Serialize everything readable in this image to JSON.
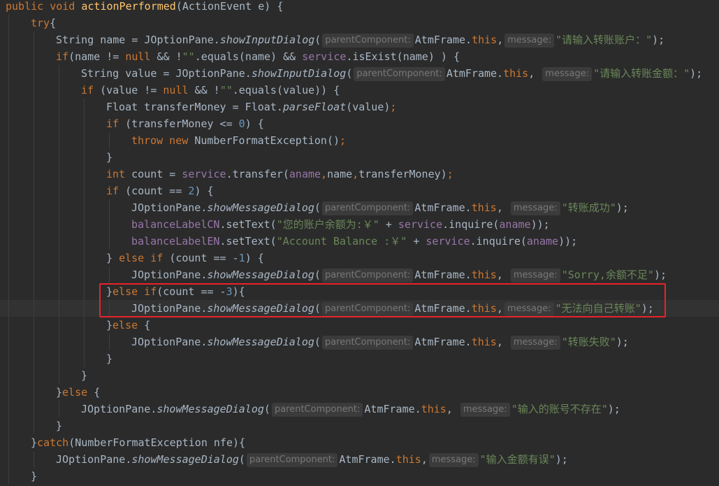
{
  "editor": {
    "lines": [
      {
        "indent": 0,
        "tokens": [
          {
            "t": "public void ",
            "c": "kw"
          },
          {
            "t": "actionPerformed",
            "c": "mth"
          },
          {
            "t": "(ActionEvent e) {"
          }
        ]
      },
      {
        "indent": 1,
        "tokens": [
          {
            "t": "try",
            "c": "kw"
          },
          {
            "t": "{"
          }
        ]
      },
      {
        "indent": 2,
        "tokens": [
          {
            "t": "String name = JOptionPane."
          },
          {
            "t": "showInputDialog",
            "c": "stat"
          },
          {
            "t": "("
          },
          {
            "t": "parentComponent:",
            "c": "hint"
          },
          {
            "t": "AtmFrame."
          },
          {
            "t": "this",
            "c": "kw"
          },
          {
            "t": ","
          },
          {
            "t": "message:",
            "c": "hint"
          },
          {
            "t": "\"请输入转账账户：\"",
            "c": "str"
          },
          {
            "t": ");"
          }
        ]
      },
      {
        "indent": 2,
        "tokens": [
          {
            "t": "if",
            "c": "kw"
          },
          {
            "t": "(name != "
          },
          {
            "t": "null",
            "c": "kw"
          },
          {
            "t": " && !"
          },
          {
            "t": "\"\"",
            "c": "str"
          },
          {
            "t": ".equals(name) && "
          },
          {
            "t": "service",
            "c": "fld"
          },
          {
            "t": ".isExist(name) ) {"
          }
        ]
      },
      {
        "indent": 3,
        "tokens": [
          {
            "t": "String value = JOptionPane."
          },
          {
            "t": "showInputDialog",
            "c": "stat"
          },
          {
            "t": "("
          },
          {
            "t": "parentComponent:",
            "c": "hint"
          },
          {
            "t": "AtmFrame."
          },
          {
            "t": "this",
            "c": "kw"
          },
          {
            "t": ", "
          },
          {
            "t": "message:",
            "c": "hint"
          },
          {
            "t": "\"请输入转账金额：\"",
            "c": "str"
          },
          {
            "t": ");"
          }
        ]
      },
      {
        "indent": 3,
        "tokens": [
          {
            "t": "if ",
            "c": "kw"
          },
          {
            "t": "(value != "
          },
          {
            "t": "null",
            "c": "kw"
          },
          {
            "t": " && !"
          },
          {
            "t": "\"\"",
            "c": "str"
          },
          {
            "t": ".equals(value)) {"
          }
        ]
      },
      {
        "indent": 4,
        "tokens": [
          {
            "t": "Float transferMoney = Float."
          },
          {
            "t": "parseFloat",
            "c": "stat"
          },
          {
            "t": "(value)"
          },
          {
            "t": ";",
            "c": "kw"
          }
        ]
      },
      {
        "indent": 4,
        "tokens": [
          {
            "t": "if ",
            "c": "kw"
          },
          {
            "t": "(transferMoney <= "
          },
          {
            "t": "0",
            "c": "num"
          },
          {
            "t": ") {"
          }
        ]
      },
      {
        "indent": 5,
        "tokens": [
          {
            "t": "throw new ",
            "c": "kw"
          },
          {
            "t": "NumberFormatException()"
          },
          {
            "t": ";",
            "c": "kw"
          }
        ]
      },
      {
        "indent": 4,
        "tokens": [
          {
            "t": "}"
          }
        ]
      },
      {
        "indent": 4,
        "tokens": [
          {
            "t": "int ",
            "c": "kw"
          },
          {
            "t": "count = "
          },
          {
            "t": "service",
            "c": "fld"
          },
          {
            "t": ".transfer("
          },
          {
            "t": "aname",
            "c": "fld"
          },
          {
            "t": ",",
            "c": "kw"
          },
          {
            "t": "name"
          },
          {
            "t": ",",
            "c": "kw"
          },
          {
            "t": "transferMoney)"
          },
          {
            "t": ";",
            "c": "kw"
          }
        ]
      },
      {
        "indent": 4,
        "tokens": [
          {
            "t": "if ",
            "c": "kw"
          },
          {
            "t": "(count == "
          },
          {
            "t": "2",
            "c": "num"
          },
          {
            "t": ") {"
          }
        ]
      },
      {
        "indent": 5,
        "tokens": [
          {
            "t": "JOptionPane."
          },
          {
            "t": "showMessageDialog",
            "c": "stat"
          },
          {
            "t": "("
          },
          {
            "t": "parentComponent:",
            "c": "hint"
          },
          {
            "t": "AtmFrame."
          },
          {
            "t": "this",
            "c": "kw"
          },
          {
            "t": ", "
          },
          {
            "t": "message:",
            "c": "hint"
          },
          {
            "t": "\"转账成功\"",
            "c": "str"
          },
          {
            "t": ");"
          }
        ]
      },
      {
        "indent": 5,
        "tokens": [
          {
            "t": "balanceLabelCN",
            "c": "fld"
          },
          {
            "t": ".setText("
          },
          {
            "t": "\"您的账户余额为:￥\"",
            "c": "str"
          },
          {
            "t": " + "
          },
          {
            "t": "service",
            "c": "fld"
          },
          {
            "t": ".inquire("
          },
          {
            "t": "aname",
            "c": "fld"
          },
          {
            "t": "));"
          }
        ]
      },
      {
        "indent": 5,
        "tokens": [
          {
            "t": "balanceLabelEN",
            "c": "fld"
          },
          {
            "t": ".setText("
          },
          {
            "t": "\"Account Balance :￥\"",
            "c": "str"
          },
          {
            "t": " + "
          },
          {
            "t": "service",
            "c": "fld"
          },
          {
            "t": ".inquire("
          },
          {
            "t": "aname",
            "c": "fld"
          },
          {
            "t": "));"
          }
        ]
      },
      {
        "indent": 4,
        "tokens": [
          {
            "t": "} "
          },
          {
            "t": "else if ",
            "c": "kw"
          },
          {
            "t": "(count == -"
          },
          {
            "t": "1",
            "c": "num"
          },
          {
            "t": ") {"
          }
        ]
      },
      {
        "indent": 5,
        "tokens": [
          {
            "t": "JOptionPane."
          },
          {
            "t": "showMessageDialog",
            "c": "stat"
          },
          {
            "t": "("
          },
          {
            "t": "parentComponent:",
            "c": "hint"
          },
          {
            "t": "AtmFrame."
          },
          {
            "t": "this",
            "c": "kw"
          },
          {
            "t": ", "
          },
          {
            "t": "message:",
            "c": "hint"
          },
          {
            "t": "\"Sorry,余额不足\"",
            "c": "str"
          },
          {
            "t": ");"
          }
        ]
      },
      {
        "indent": 4,
        "tokens": [
          {
            "t": "}"
          },
          {
            "t": "else if",
            "c": "kw"
          },
          {
            "t": "(count == -"
          },
          {
            "t": "3",
            "c": "num"
          },
          {
            "t": "){"
          }
        ]
      },
      {
        "indent": 5,
        "tokens": [
          {
            "t": "JOptionPane."
          },
          {
            "t": "showMessageDialog",
            "c": "stat"
          },
          {
            "t": "("
          },
          {
            "t": "parentComponent:",
            "c": "hint"
          },
          {
            "t": "AtmFrame."
          },
          {
            "t": "this",
            "c": "kw"
          },
          {
            "t": ","
          },
          {
            "t": "message:",
            "c": "hint"
          },
          {
            "t": "\"无法向自己转账\"",
            "c": "str"
          },
          {
            "t": ");"
          }
        ]
      },
      {
        "indent": 4,
        "tokens": [
          {
            "t": "}"
          },
          {
            "t": "else ",
            "c": "kw"
          },
          {
            "t": "{"
          }
        ]
      },
      {
        "indent": 5,
        "tokens": [
          {
            "t": "JOptionPane."
          },
          {
            "t": "showMessageDialog",
            "c": "stat"
          },
          {
            "t": "("
          },
          {
            "t": "parentComponent:",
            "c": "hint"
          },
          {
            "t": "AtmFrame."
          },
          {
            "t": "this",
            "c": "kw"
          },
          {
            "t": ", "
          },
          {
            "t": "message:",
            "c": "hint"
          },
          {
            "t": "\"转账失败\"",
            "c": "str"
          },
          {
            "t": ");"
          }
        ]
      },
      {
        "indent": 4,
        "tokens": [
          {
            "t": "}"
          }
        ]
      },
      {
        "indent": 3,
        "tokens": [
          {
            "t": "}"
          }
        ]
      },
      {
        "indent": 2,
        "tokens": [
          {
            "t": "}"
          },
          {
            "t": "else ",
            "c": "kw"
          },
          {
            "t": "{"
          }
        ]
      },
      {
        "indent": 3,
        "tokens": [
          {
            "t": "JOptionPane."
          },
          {
            "t": "showMessageDialog",
            "c": "stat"
          },
          {
            "t": "("
          },
          {
            "t": "parentComponent:",
            "c": "hint"
          },
          {
            "t": "AtmFrame."
          },
          {
            "t": "this",
            "c": "kw"
          },
          {
            "t": ", "
          },
          {
            "t": "message:",
            "c": "hint"
          },
          {
            "t": "\"输入的账号不存在\"",
            "c": "str"
          },
          {
            "t": ");"
          }
        ]
      },
      {
        "indent": 2,
        "tokens": [
          {
            "t": "}"
          }
        ]
      },
      {
        "indent": 1,
        "tokens": [
          {
            "t": "}"
          },
          {
            "t": "catch",
            "c": "kw"
          },
          {
            "t": "(NumberFormatException nfe){"
          }
        ]
      },
      {
        "indent": 2,
        "tokens": [
          {
            "t": "JOptionPane."
          },
          {
            "t": "showMessageDialog",
            "c": "stat"
          },
          {
            "t": "("
          },
          {
            "t": "parentComponent:",
            "c": "hint"
          },
          {
            "t": "AtmFrame."
          },
          {
            "t": "this",
            "c": "kw"
          },
          {
            "t": ","
          },
          {
            "t": "message:",
            "c": "hint"
          },
          {
            "t": "\"输入金额有误\"",
            "c": "str"
          },
          {
            "t": ");"
          }
        ]
      },
      {
        "indent": 1,
        "tokens": [
          {
            "t": "}"
          }
        ]
      }
    ]
  },
  "colors": {
    "background": "#2b2b2b",
    "keyword": "#cc7832",
    "string": "#6a8759",
    "number": "#6897bb",
    "field": "#9876aa",
    "method_decl": "#ffc66d",
    "plain": "#a9b7c6",
    "inlay_hint": "#787878",
    "highlight_box": "#e8232a"
  }
}
